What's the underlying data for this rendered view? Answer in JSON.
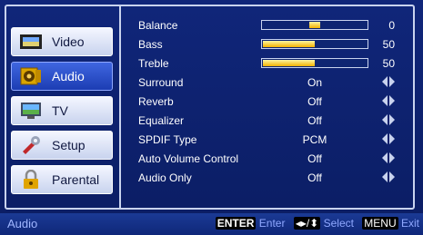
{
  "sidebar": {
    "items": [
      {
        "label": "Video",
        "icon": "film-icon"
      },
      {
        "label": "Audio",
        "icon": "speaker-icon"
      },
      {
        "label": "TV",
        "icon": "television-icon"
      },
      {
        "label": "Setup",
        "icon": "wrench-icon"
      },
      {
        "label": "Parental",
        "icon": "lock-icon"
      }
    ],
    "selected": "Audio"
  },
  "settings": {
    "balance": {
      "label": "Balance",
      "value": "0",
      "level": 0.5
    },
    "bass": {
      "label": "Bass",
      "value": "50",
      "level": 0.5
    },
    "treble": {
      "label": "Treble",
      "value": "50",
      "level": 0.5
    },
    "surround": {
      "label": "Surround",
      "value": "On"
    },
    "reverb": {
      "label": "Reverb",
      "value": "Off"
    },
    "equalizer": {
      "label": "Equalizer",
      "value": "Off"
    },
    "spdif": {
      "label": "SPDIF Type",
      "value": "PCM"
    },
    "avc": {
      "label": "Auto Volume Control",
      "value": "Off"
    },
    "audio_only": {
      "label": "Audio Only",
      "value": "Off"
    }
  },
  "footer": {
    "status": "Audio",
    "enter_key": "ENTER",
    "enter_label": "Enter",
    "select_key": "◂▸/⬍",
    "select_label": "Select",
    "menu_key": "MENU",
    "menu_label": "Exit"
  },
  "colors": {
    "accent": "#2b4fd0",
    "bar_fill": "#f2b200",
    "background": "#10267a"
  }
}
